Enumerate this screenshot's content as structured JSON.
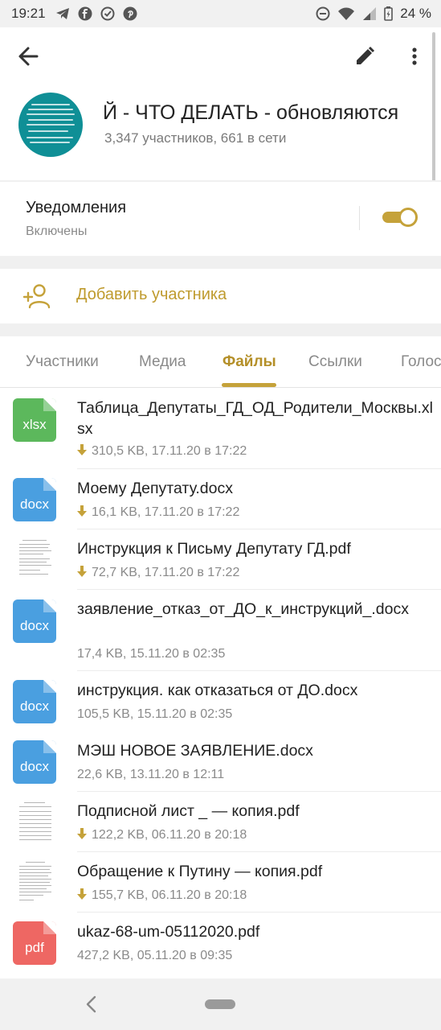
{
  "status_bar": {
    "time": "19:21",
    "left_icons": [
      "telegram-icon",
      "facebook-icon",
      "check-circle-icon",
      "pinterest-icon"
    ],
    "right_icons": [
      "dnd-icon",
      "wifi-icon",
      "signal-icon",
      "battery-icon"
    ],
    "battery_percent": "24 %"
  },
  "header": {
    "title": "Й - ЧТО ДЕЛАТЬ - обновляются",
    "subtitle": "3,347 участников, 661 в сети",
    "avatar_color": "#0f8f96"
  },
  "notifications": {
    "title": "Уведомления",
    "status": "Включены",
    "enabled": true
  },
  "add_member": {
    "label": "Добавить участника"
  },
  "tabs": [
    {
      "label": "Участники",
      "active": false
    },
    {
      "label": "Медиа",
      "active": false
    },
    {
      "label": "Файлы",
      "active": true
    },
    {
      "label": "Ссылки",
      "active": false
    },
    {
      "label": "Голос",
      "active": false
    }
  ],
  "files": [
    {
      "name": "Таблица_Депутаты_ГД_ОД_Родители_Москвы.xlsx",
      "meta": "310,5 KB, 17.11.20 в 17:22",
      "icon": "xlsx",
      "downloaded": false
    },
    {
      "name": "Моему Депутату.docx",
      "meta": "16,1 KB, 17.11.20 в 17:22",
      "icon": "docx",
      "downloaded": false
    },
    {
      "name": "Инструкция к Письму Депутату ГД.pdf",
      "meta": "72,7 KB, 17.11.20 в 17:22",
      "icon": "thumbnail",
      "downloaded": false
    },
    {
      "name": "заявление_отказ_от_ДО_к_инструкций_.docx",
      "meta": "17,4 KB, 15.11.20 в 02:35",
      "icon": "docx",
      "downloaded": true
    },
    {
      "name": "инструкция. как отказаться от ДО.docx",
      "meta": "105,5 KB, 15.11.20 в 02:35",
      "icon": "docx",
      "downloaded": true
    },
    {
      "name": "МЭШ НОВОЕ ЗАЯВЛЕНИЕ.docx",
      "meta": "22,6 KB, 13.11.20 в 12:11",
      "icon": "docx",
      "downloaded": true
    },
    {
      "name": "Подписной лист _ — копия.pdf",
      "meta": "122,2 KB, 06.11.20 в 20:18",
      "icon": "thumbnail",
      "downloaded": false
    },
    {
      "name": "Обращение к Путину — копия.pdf",
      "meta": "155,7 KB, 06.11.20 в 20:18",
      "icon": "thumbnail",
      "downloaded": false
    },
    {
      "name": "ukaz-68-um-05112020.pdf",
      "meta": "427,2 KB, 05.11.20 в 09:35",
      "icon": "pdf",
      "downloaded": true
    }
  ],
  "colors": {
    "accent": "#c5a23a",
    "xlsx": "#5cb85c",
    "docx": "#4a9fe0",
    "pdf": "#ee6763"
  }
}
